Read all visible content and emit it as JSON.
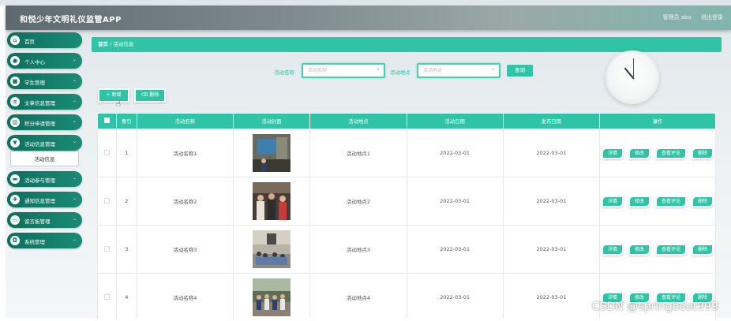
{
  "app": {
    "title": "和悦少年文明礼仪监管APP"
  },
  "user": {
    "role": "管理员 abo",
    "logout": "退出登录"
  },
  "sidebar": {
    "items": [
      {
        "label": "首页",
        "icon": "home-icon",
        "glyph": "⌂",
        "chevron": ""
      },
      {
        "label": "个人中心",
        "icon": "person-icon",
        "glyph": "●",
        "chevron": "⌄"
      },
      {
        "label": "学生管理",
        "icon": "student-icon",
        "glyph": "■",
        "chevron": "⌄"
      },
      {
        "label": "文章信息管理",
        "icon": "article-icon",
        "glyph": "≡",
        "chevron": "⌄"
      },
      {
        "label": "积分申请管理",
        "icon": "chart-icon",
        "glyph": "▥",
        "chevron": "⌄"
      },
      {
        "label": "活动信息管理",
        "icon": "activity-icon",
        "glyph": "▼",
        "chevron": "⌄"
      },
      {
        "label": "活动参与管理",
        "icon": "participation-icon",
        "glyph": "▬",
        "chevron": "⌄"
      },
      {
        "label": "通知信息管理",
        "icon": "notice-icon",
        "glyph": "✚",
        "chevron": "⌄"
      },
      {
        "label": "留言板管理",
        "icon": "message-icon",
        "glyph": "▭",
        "chevron": "⌄"
      },
      {
        "label": "系统管理",
        "icon": "system-icon",
        "glyph": "◘",
        "chevron": "⌄"
      }
    ],
    "active_sub": "活动信息"
  },
  "breadcrumb": {
    "home": "首页",
    "sep": "/",
    "current": "活动信息"
  },
  "search": {
    "name_label": "活动名称",
    "name_placeholder": "活动名称",
    "place_label": "活动地点",
    "place_placeholder": "活动地点",
    "query_button": "查询"
  },
  "actions": {
    "add": "+ 新增",
    "delete": "⌫ 删除"
  },
  "table": {
    "headers": [
      "索引",
      "活动名称",
      "活动封面",
      "活动地点",
      "活动日期",
      "发布日期",
      "操作"
    ],
    "rows": [
      {
        "index": "1",
        "name": "活动名称1",
        "place": "活动地点1",
        "date": "2022-03-01",
        "publish": "2022-03-01"
      },
      {
        "index": "2",
        "name": "活动名称2",
        "place": "活动地点2",
        "date": "2022-03-01",
        "publish": "2022-03-01"
      },
      {
        "index": "3",
        "name": "活动名称3",
        "place": "活动地点3",
        "date": "2022-03-01",
        "publish": "2022-03-01"
      },
      {
        "index": "4",
        "name": "活动名称4",
        "place": "活动地点4",
        "date": "2022-03-01",
        "publish": "2022-03-01"
      }
    ],
    "row_ops": {
      "detail": "详情",
      "edit": "修改",
      "comments": "查看评论",
      "delete": "删除"
    }
  },
  "watermark": "CSDN @springboot999",
  "colors": {
    "accent": "#2ec4a5",
    "sidebar": "#127a66"
  }
}
